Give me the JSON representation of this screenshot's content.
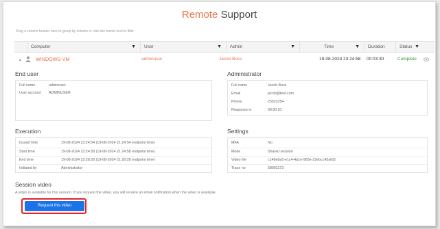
{
  "title": {
    "accent": "Remote",
    "rest": "Support"
  },
  "hint": "Drag a column header here to group by column or click the funnel icon to filter",
  "columns": [
    {
      "label": "Computer",
      "filterable": true
    },
    {
      "label": "User",
      "filterable": true
    },
    {
      "label": "Admin",
      "filterable": true
    },
    {
      "label": "Time",
      "filterable": true
    },
    {
      "label": "Duration",
      "filterable": false
    },
    {
      "label": "Status",
      "filterable": true
    }
  ],
  "filter_glyph": "▼",
  "row": {
    "computer": "WINDOWS-VM",
    "user": "adminuser",
    "admin": "Jacob Boss",
    "time": "19-08-2024 23:24:58",
    "duration": "00:03:30",
    "status": "Complete"
  },
  "end_user": {
    "title": "End user",
    "items": [
      {
        "k": "Full name",
        "v": "adminuser"
      },
      {
        "k": "User account",
        "v": "ADMINUSER"
      }
    ]
  },
  "administrator": {
    "title": "Administrator",
    "items": [
      {
        "k": "Full name",
        "v": "Jacob Boss"
      },
      {
        "k": "Email",
        "v": "jacob@test.com"
      },
      {
        "k": "Phone",
        "v": "25522254"
      },
      {
        "k": "Response in",
        "v": "00:00:01"
      }
    ]
  },
  "execution": {
    "title": "Execution",
    "items": [
      {
        "k": "Issued time",
        "v": "19-08-2024 23:24:54 (19-08-2024 21:24:54 endpoint time)"
      },
      {
        "k": "Start time",
        "v": "19-08-2024 23:24:58 (19-08-2024 21:24:58 endpoint time)"
      },
      {
        "k": "End time",
        "v": "19-08-2024 23:28:28 (19-08-2024 21:28:28 endpoint time)"
      },
      {
        "k": "Initiated by",
        "v": "Administrator"
      }
    ]
  },
  "settings": {
    "title": "Settings",
    "items": [
      {
        "k": "MFA",
        "v": "No"
      },
      {
        "k": "Mode",
        "v": "Shared session"
      },
      {
        "k": "Video file",
        "v": "c148e8a5-e1c4-4a1e-965e-22ebcc43afd3"
      },
      {
        "k": "Trace no",
        "v": "58001173"
      }
    ]
  },
  "video": {
    "title": "Session video",
    "note": "A video is available for this session. If you request the video, you will receive an email notification when the video is available.",
    "button_label": "Request this video"
  },
  "colors": {
    "accent": "#e8734a",
    "success": "#2e9a2e",
    "primary": "#1a73e8",
    "highlight": "#e0242a"
  }
}
